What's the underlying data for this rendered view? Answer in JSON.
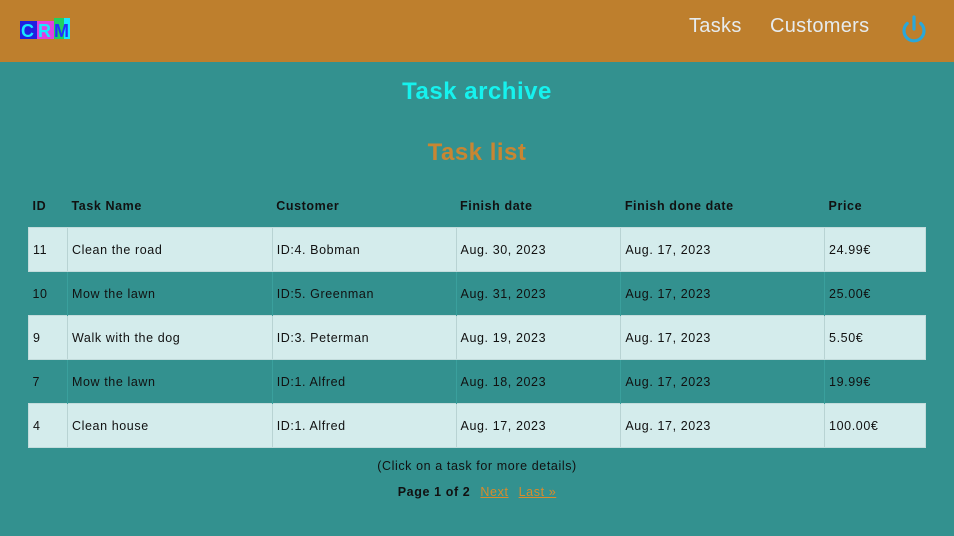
{
  "header": {
    "logo_text": "CRM",
    "nav": {
      "tasks": "Tasks",
      "customers": "Customers"
    },
    "logout_icon": "power-icon"
  },
  "main": {
    "title": "Task archive",
    "list_title": "Task list",
    "columns": [
      "ID",
      "Task Name",
      "Customer",
      "Finish date",
      "Finish done date",
      "Price"
    ],
    "rows": [
      [
        "11",
        "Clean the road",
        "ID:4. Bobman",
        "Aug. 30, 2023",
        "Aug. 17, 2023",
        "24.99€"
      ],
      [
        "10",
        "Mow the lawn",
        "ID:5. Greenman",
        "Aug. 31, 2023",
        "Aug. 17, 2023",
        "25.00€"
      ],
      [
        "9",
        "Walk with the dog",
        "ID:3. Peterman",
        "Aug. 19, 2023",
        "Aug. 17, 2023",
        "5.50€"
      ],
      [
        "7",
        "Mow the lawn",
        "ID:1. Alfred",
        "Aug. 18, 2023",
        "Aug. 17, 2023",
        "19.99€"
      ],
      [
        "4",
        "Clean house",
        "ID:1. Alfred",
        "Aug. 17, 2023",
        "Aug. 17, 2023",
        "100.00€"
      ]
    ],
    "hint": "(Click on a task for more details)",
    "pagination": {
      "current": "Page 1 of 2",
      "next": "Next",
      "last": "Last »"
    }
  },
  "colors": {
    "header_bg": "#be7f2d",
    "page_bg": "#33918f",
    "title": "#16f2ee",
    "list_title": "#c88632",
    "row_light": "#d4ecec",
    "link": "#d98b2b",
    "power_icon": "#2aa7d9"
  }
}
